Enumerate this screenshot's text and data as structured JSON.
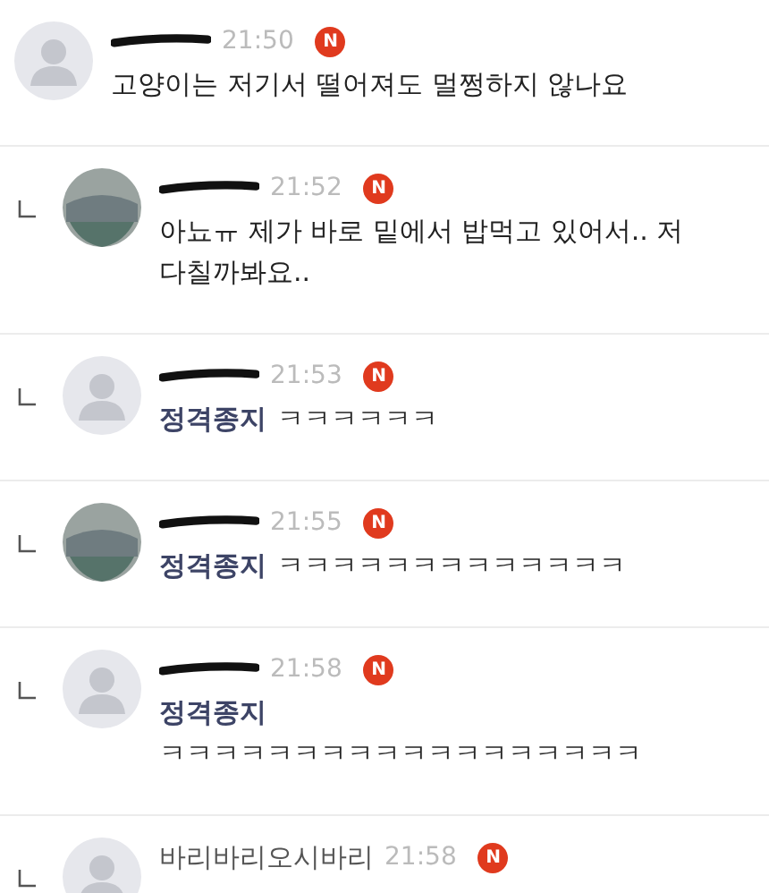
{
  "comments": [
    {
      "reply": false,
      "avatar_photo": false,
      "redacted": true,
      "time": "21:50",
      "new_badge": "N",
      "text": "고양이는 저기서 떨어져도 멀쩡하지 않나요"
    },
    {
      "reply": true,
      "avatar_photo": true,
      "redacted": true,
      "time": "21:52",
      "new_badge": "N",
      "text": "아뇨ㅠ 제가 바로 밑에서 밥먹고 있어서.. 저 다칠까봐요.."
    },
    {
      "reply": true,
      "avatar_photo": false,
      "redacted": true,
      "time": "21:53",
      "new_badge": "N",
      "mention": "정격종지",
      "text": "ㅋㅋㅋㅋㅋㅋ"
    },
    {
      "reply": true,
      "avatar_photo": true,
      "redacted": true,
      "time": "21:55",
      "new_badge": "N",
      "mention": "정격종지",
      "text": "ㅋㅋㅋㅋㅋㅋㅋㅋㅋㅋㅋㅋㅋ"
    },
    {
      "reply": true,
      "avatar_photo": false,
      "redacted": true,
      "time": "21:58",
      "new_badge": "N",
      "mention": "정격종지",
      "text": "ㅋㅋㅋㅋㅋㅋㅋㅋㅋㅋㅋㅋㅋㅋㅋㅋㅋㅋ"
    },
    {
      "reply": true,
      "avatar_photo": false,
      "redacted": false,
      "name": "바리바리오시바리",
      "time": "21:58",
      "new_badge": "N"
    }
  ]
}
